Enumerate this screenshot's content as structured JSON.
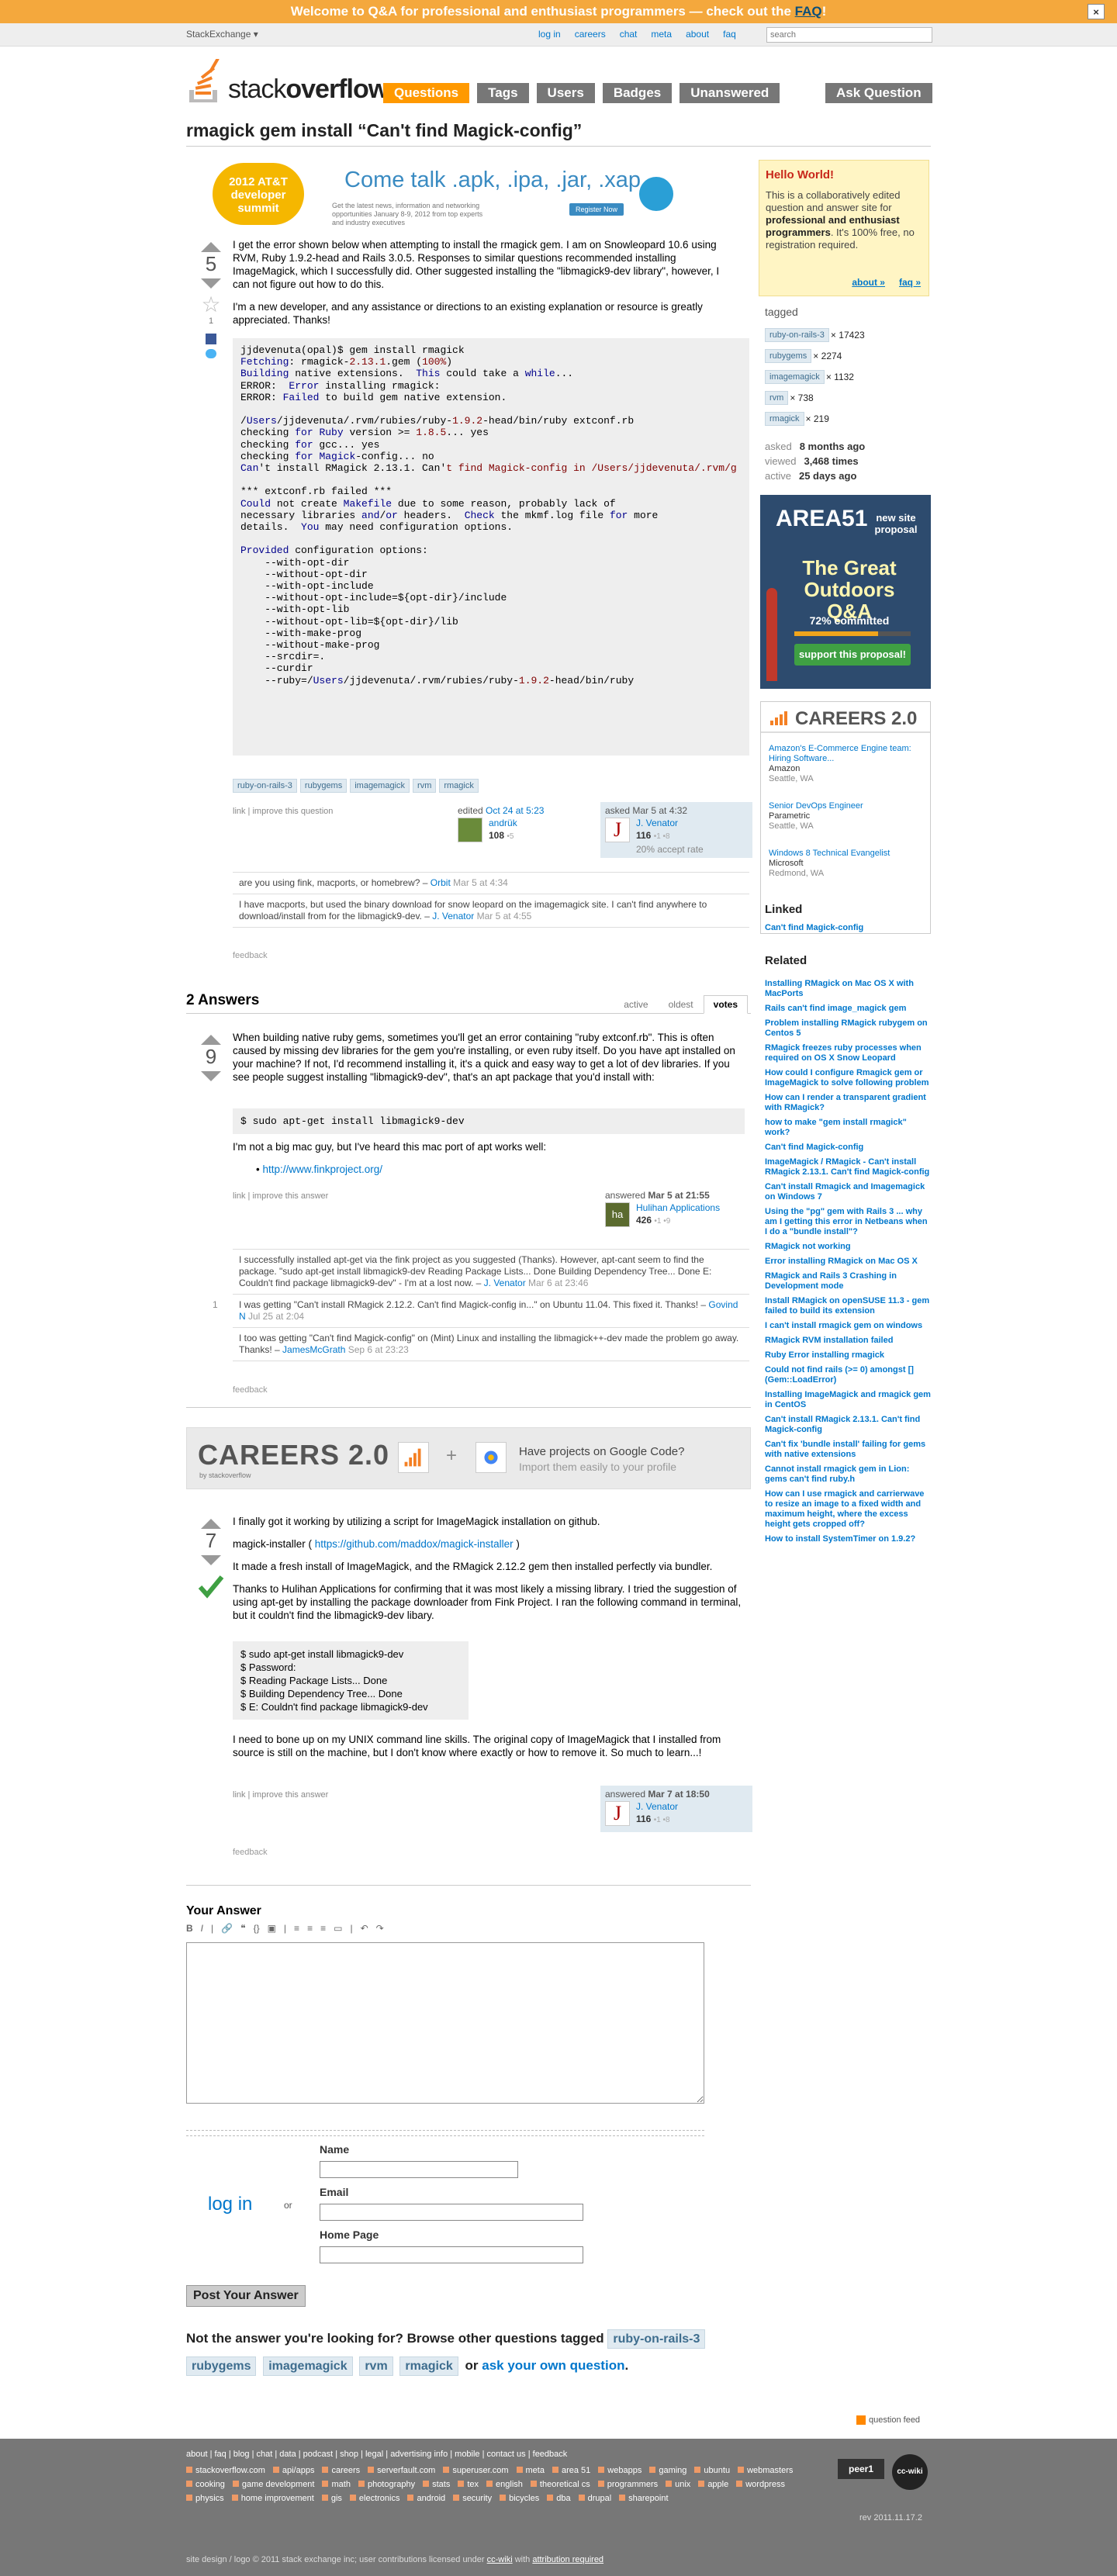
{
  "notify": {
    "text": "Welcome to Q&A for professional and enthusiast programmers — check out the ",
    "faq": "FAQ",
    "tail": "!",
    "close": "×"
  },
  "topbar": {
    "brand": "StackExchange ▾",
    "links": [
      "log in",
      "careers",
      "chat",
      "meta",
      "about",
      "faq"
    ],
    "search_placeholder": "search"
  },
  "logo": {
    "part1": "stack",
    "part2": "overflow"
  },
  "nav": {
    "tabs": [
      "Questions",
      "Tags",
      "Users",
      "Badges",
      "Unanswered"
    ],
    "active": "Questions",
    "ask": "Ask Question"
  },
  "question": {
    "title": "rmagick gem install “Can't find Magick-config”",
    "votes": "5",
    "favorites": "1",
    "p1": "I get the error shown below when attempting to install the rmagick gem. I am on Snowleopard 10.6 using RVM, Ruby 1.9.2-head and Rails 3.0.5. Responses to similar questions recommended installing ImageMagick, which I successfully did. Other suggested installing the \"libmagick9-dev library\", however, I can not figure out how to do this.",
    "p2": "I'm a new developer, and any assistance or directions to an existing explanation or resource is greatly appreciated. Thanks!",
    "tags": [
      "ruby-on-rails-3",
      "rubygems",
      "imagemagick",
      "rvm",
      "rmagick"
    ],
    "menu": "link | improve this question",
    "edited": {
      "label": "edited",
      "date": "Oct 24 at 5:23",
      "user": "andrük",
      "rep": "108",
      "badges": "•5"
    },
    "asked": {
      "label": "asked",
      "date": "Mar 5 at 4:32",
      "user": "J. Venator",
      "rep": "116",
      "badges": "•1 •8",
      "rate": "20% accept rate",
      "avatar": "J"
    },
    "comments": [
      {
        "text": "are you using fink, macports, or homebrew? – ",
        "user": "Orbit",
        "date": " Mar 5 at 4:34"
      },
      {
        "text": "I have macports, but used the binary download for snow leopard on the imagemagick site. I can't find anywhere to download/install from for the libmagick9-dev. – ",
        "user": "J. Venator",
        "date": " Mar 5 at 4:55"
      }
    ],
    "feedback": "feedback"
  },
  "ad": {
    "summit_line1": "2012 AT&T",
    "summit_line2": "developer",
    "summit_line3": "summit",
    "headline": "Come talk .apk, .ipa, .jar, .xap",
    "sub": "Get the latest news, information and networking opportunities January 8-9, 2012 from top experts and industry executives",
    "register": "Register Now"
  },
  "answers": {
    "title": "2 Answers",
    "sort": [
      "active",
      "oldest",
      "votes"
    ],
    "a1": {
      "votes": "9",
      "p1": "When building native ruby gems, sometimes you'll get an error containing \"ruby extconf.rb\". This is often caused by missing dev libraries for the gem you're installing, or even ruby itself. Do you have apt installed on your machine? If not, I'd recommend installing it, it's a quick and easy way to get a lot of dev libraries. If you see people suggest installing \"libmagick9-dev\", that's an apt package that you'd install with:",
      "code": "$ sudo apt-get install libmagick9-dev",
      "p2": "I'm not a big mac guy, but I've heard this mac port of apt works well:",
      "link": "http://www.finkproject.org/",
      "menu": "link | improve this answer",
      "answered": {
        "label": "answered",
        "date": "Mar 5 at 21:55",
        "user": "Hulihan Applications",
        "rep": "426",
        "badges": "•1 •9",
        "avatar": "ha"
      },
      "comments": [
        {
          "num": "",
          "text": "I successfully installed apt-get via the fink project as you suggested (Thanks). However, apt-cant seem to find the package. \"sudo apt-get install libmagick9-dev Reading Package Lists... Done Building Dependency Tree... Done E: Couldn't find package libmagick9-dev\" - I'm at a lost now. – ",
          "user": "J. Venator",
          "date": " Mar 6 at 23:46"
        },
        {
          "num": "1",
          "text": "I was getting \"Can't install RMagick 2.12.2. Can't find Magick-config in...\" on Ubuntu 11.04. This fixed it. Thanks! – ",
          "user": "Govind N",
          "date": " Jul 25 at 2:04"
        },
        {
          "num": "",
          "text": "I too was getting \"Can't find Magick-config\" on (Mint) Linux and installing the libmagick++-dev made the problem go away. Thanks! – ",
          "user": "JamesMcGrath",
          "date": " Sep 6 at 23:23"
        }
      ],
      "feedback": "feedback"
    },
    "a2": {
      "votes": "7",
      "p1": "I finally got it working by utilizing a script for ImageMagick installation on github.",
      "p2a": "magick-installer ( ",
      "p2link": "https://github.com/maddox/magick-installer",
      "p2b": " )",
      "p3": "It made a fresh install of ImageMagick, and the RMagick 2.12.2 gem then installed perfectly via bundler.",
      "p4": "Thanks to Hulihan Applications for confirming that it was most likely a missing library. I tried the suggestion of using apt-get by installing the package downloader from Fink Project. I ran the following command in terminal, but it couldn't find the libmagick9-dev libary.",
      "code": [
        "$ sudo apt-get install libmagick9-dev",
        "$ Password:",
        "$ Reading Package Lists... Done",
        "$ Building Dependency Tree... Done",
        "$ E: Couldn't find package libmagick9-dev"
      ],
      "p5": "I need to bone up on my UNIX command line skills. The original copy of ImageMagick that I installed from source is still on the machine, but I don't know where exactly or how to remove it. So much to learn...!",
      "menu": "link | improve this answer",
      "answered": {
        "label": "answered",
        "date": "Mar 7 at 18:50",
        "user": "J. Venator",
        "rep": "116",
        "badges": "•1 •8",
        "avatar": "J"
      },
      "feedback": "feedback"
    }
  },
  "careers_banner": {
    "title": "CAREERS 2.0",
    "by": "by stackoverflow",
    "plus": "+",
    "line1": "Have projects on Google Code?",
    "line2": "Import them easily to your profile"
  },
  "your_answer": {
    "title": "Your Answer",
    "toolbar": [
      "B",
      "I",
      "|",
      "🔗",
      "❝",
      "{}",
      "▣",
      "|",
      "≡",
      "≡",
      "≡",
      "▭",
      "|",
      "↶",
      "↷"
    ],
    "login": "log in",
    "or": "or",
    "name_label": "Name",
    "email_label": "Email",
    "home_label": "Home Page",
    "post": "Post Your Answer",
    "notlooking": "Not the answer you're looking for? Browse other questions tagged",
    "notlooking_tags": [
      "ruby-on-rails-3",
      "rubygems",
      "imagemagick",
      "rvm",
      "rmagick"
    ],
    "or_ask": " or ",
    "ask_own": "ask your own question",
    "period": "."
  },
  "sidebar": {
    "hello_title": "Hello World!",
    "hello_text1": "This is a collaboratively edited question and answer site for ",
    "hello_bold": "professional and enthusiast programmers",
    "hello_text2": ". It's 100% free, no registration required.",
    "about": "about »",
    "faq": "faq »",
    "tagged_label": "tagged",
    "tags": [
      {
        "name": "ruby-on-rails-3",
        "count": "× 17423"
      },
      {
        "name": "rubygems",
        "count": "× 2274"
      },
      {
        "name": "imagemagick",
        "count": "× 1132"
      },
      {
        "name": "rvm",
        "count": "× 738"
      },
      {
        "name": "rmagick",
        "count": "× 219"
      }
    ],
    "stats": [
      {
        "label": "asked",
        "value": "8 months ago"
      },
      {
        "label": "viewed",
        "value": "3,468 times"
      },
      {
        "label": "active",
        "value": "25 days ago"
      }
    ],
    "area51": {
      "title": "AREA51",
      "newsite": "new site proposal",
      "great": "The Great Outdoors Q&A",
      "committed": "72% committed",
      "committed_pct": 0.72,
      "support": "support this proposal!"
    },
    "careers": {
      "title": "CAREERS 2.0",
      "jobs": [
        {
          "title": "Amazon's E-Commerce Engine team: Hiring Software...",
          "company": "Amazon",
          "location": "Seattle, WA"
        },
        {
          "title": "Senior DevOps Engineer",
          "company": "Parametric",
          "location": "Seattle, WA"
        },
        {
          "title": "Windows 8 Technical Evangelist",
          "company": "Microsoft",
          "location": "Redmond, WA"
        }
      ]
    },
    "linked_title": "Linked",
    "linked": [
      "Can't find Magick-config"
    ],
    "related_title": "Related",
    "related": [
      "Installing RMagick on Mac OS X with MacPorts",
      "Rails can't find image_magick gem",
      "Problem installing RMagick rubygem on Centos 5",
      "RMagick freezes ruby processes when required on OS X Snow Leopard",
      "How could I configure Rmagick gem or ImageMagick to solve following problem",
      "How can I render a transparent gradient with RMagick?",
      "how to make \"gem install rmagick\" work?",
      "Can't find Magick-config",
      "ImageMagick / RMagick - Can't install RMagick 2.13.1. Can't find Magick-config",
      "Can't install Rmagick and Imagemagick on Windows 7",
      "Using the \"pg\" gem with Rails 3 ... why am I getting this error in Netbeans when I do a \"bundle install\"?",
      "RMagick not working",
      "Error installing RMagick on Mac OS X",
      "RMagick and Rails 3 Crashing in Development mode",
      "Install RMagick on openSUSE 11.3 - gem failed to build its extension",
      "I can't install rmagick gem on windows",
      "RMagick RVM installation failed",
      "Ruby Error installing rmagick",
      "Could not find rails (>= 0) amongst [] (Gem::LoadError)",
      "Installing ImageMagick and rmagick gem in CentOS",
      "Can't install RMagick 2.13.1. Can't find Magick-config",
      "Can't fix 'bundle install' failing for gems with native extensions",
      "Cannot install rmagick gem in Lion: gems can't find ruby.h",
      "How can I use rmagick and carrierwave to resize an image to a fixed width and maximum height, where the excess height gets cropped off?",
      "How to install SystemTimer on 1.9.2?"
    ],
    "qfeed": "question feed"
  },
  "footer": {
    "links": "about | faq | blog | chat | data | podcast | shop | legal | advertising info | mobile | contact us | feedback",
    "sites": [
      "stackoverflow.com",
      "api/apps",
      "careers",
      "serverfault.com",
      "superuser.com",
      "meta",
      "area 51",
      "webapps",
      "gaming",
      "ubuntu",
      "webmasters",
      "cooking",
      "game development",
      "math",
      "photography",
      "stats",
      "tex",
      "english",
      "theoretical cs",
      "programmers",
      "unix",
      "apple",
      "wordpress",
      "physics",
      "home improvement",
      "gis",
      "electronics",
      "android",
      "security",
      "bicycles",
      "dba",
      "drupal",
      "sharepoint"
    ],
    "legal_pre": "site design / logo © 2011 stack exchange inc; user contributions licensed under ",
    "legal_cc": "cc-wiki",
    "legal_mid": " with ",
    "legal_attr": "attribution required",
    "peer1": "peer1",
    "ccwiki": "cc-wiki",
    "rev": "rev 2011.11.17.2"
  },
  "colors": {
    "accent": "#f90",
    "notify": "#f4a83d",
    "link": "#0077cc",
    "tag_bg": "#e0eaf1",
    "accepted": "#3fa043"
  }
}
